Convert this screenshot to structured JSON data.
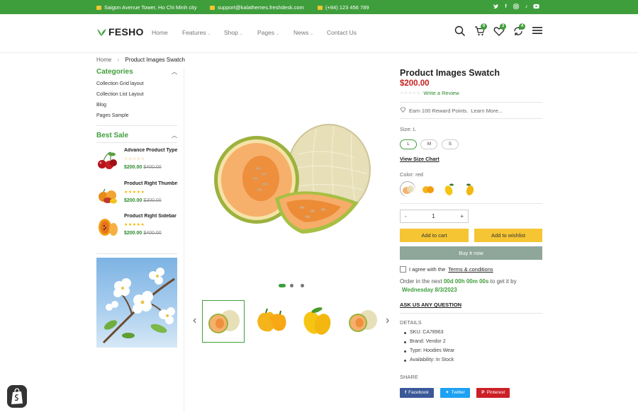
{
  "topbar": {
    "address": "Saigon Avenue Tower, Ho Chi Minh city",
    "email": "support@kalathemes.freshdesk.com",
    "phone": "(+84) 123 456 789",
    "social": [
      "twitter-icon",
      "facebook-icon",
      "instagram-icon",
      "tiktok-icon",
      "youtube-icon"
    ],
    "color": "#3f9e3c"
  },
  "header": {
    "logo": "FESHO",
    "nav": [
      {
        "label": "Home",
        "dropdown": false
      },
      {
        "label": "Features",
        "dropdown": true
      },
      {
        "label": "Shop",
        "dropdown": true
      },
      {
        "label": "Pages",
        "dropdown": true
      },
      {
        "label": "News",
        "dropdown": true
      },
      {
        "label": "Contact Us",
        "dropdown": false
      }
    ],
    "cart_count": "0",
    "wishlist_count": "3",
    "compare_count": "4"
  },
  "breadcrumb": {
    "home": "Home",
    "separator": "›",
    "current": "Product Images Swatch"
  },
  "sidebar": {
    "categories_title": "Categories",
    "categories": [
      "Collection Grid layout",
      "Collection List Layout",
      "Blog",
      "Pages Sample"
    ],
    "best_sale_title": "Best Sale",
    "products": [
      {
        "title": "Advance Product Type",
        "price": "$200.00",
        "old_price": "$400.00",
        "stars": "☆☆☆☆☆",
        "image": "cherries-image"
      },
      {
        "title": "Product Right Thumbnail",
        "price": "$200.00",
        "old_price": "$300.00",
        "stars": "★★★★★",
        "image": "fruit-mix-image"
      },
      {
        "title": "Product Right Sidebar",
        "price": "$200.00",
        "old_price": "$400.00",
        "stars": "★★★★★",
        "image": "papaya-image"
      }
    ]
  },
  "product": {
    "title": "Product Images Swatch",
    "price": "$200.00",
    "review_stars": "☆☆☆☆☆",
    "write_review": "Write a Review",
    "reward": "Earn 100 Reward Points.",
    "learn_more": "Learn More...",
    "size_label": "Size: L",
    "sizes": [
      "L",
      "M",
      "S"
    ],
    "selected_size": "L",
    "view_size_chart": "View Size Chart",
    "color_label": "Color: red",
    "qty": "1",
    "qty_minus": "-",
    "qty_plus": "+",
    "add_to_cart": "Add to cart",
    "add_to_wishlist": "Add to wishlist",
    "buy_now": "Buy it now",
    "agree_prefix": "I agree with the",
    "terms": "Terms & conditions",
    "order_prefix": "Order in the next",
    "countdown": "00d 00h 00m 00s",
    "order_suffix": "to get it by",
    "delivery_date": "Wednesday 8/3/2023",
    "ask": "ASK US ANY QUESTION",
    "details_title": "DETAILS",
    "details": [
      {
        "k": "SKU:",
        "v": "CA78963"
      },
      {
        "k": "Brand:",
        "v": "Vendor 2"
      },
      {
        "k": "Type:",
        "v": "Hoodies Wear"
      },
      {
        "k": "Availability:",
        "v": "In Stock"
      }
    ],
    "share_title": "SHARE",
    "share": [
      {
        "label": "Facebook",
        "color": "#3b5998"
      },
      {
        "label": "Twitter",
        "color": "#1da1f2"
      },
      {
        "label": "Pinterest",
        "color": "#cb2027"
      }
    ],
    "accent": "#3f9e3c",
    "price_color": "#c62020"
  }
}
